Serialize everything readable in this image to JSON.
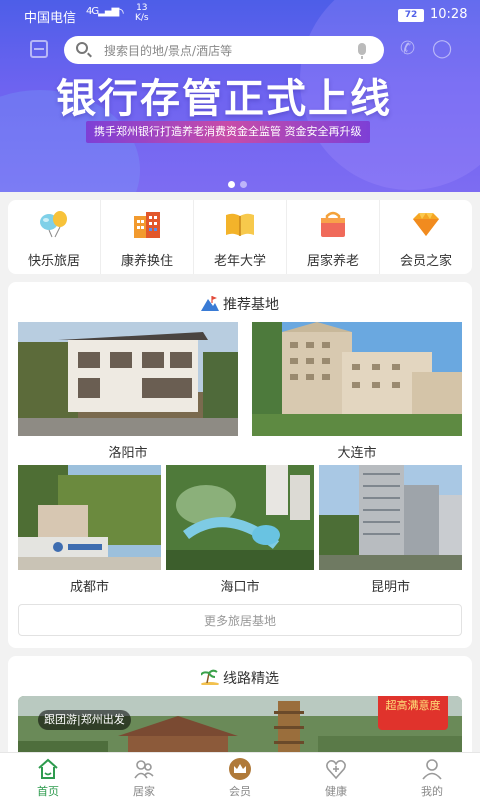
{
  "status_bar": {
    "carrier": "中国电信",
    "network": "4G",
    "speed_value": "13",
    "speed_unit": "K/s",
    "battery": "72",
    "time": "10:28"
  },
  "search": {
    "placeholder": "搜索目的地/景点/酒店等"
  },
  "banner": {
    "title": "银行存管正式上线",
    "subtitle": "携手郑州银行打造养老消费资金全监管  资金安全再升级",
    "slides": 2,
    "active_slide": 0
  },
  "categories": [
    {
      "label": "快乐旅居",
      "icon": "balloon-icon"
    },
    {
      "label": "康养换住",
      "icon": "building-icon"
    },
    {
      "label": "老年大学",
      "icon": "book-icon"
    },
    {
      "label": "居家养老",
      "icon": "shopping-bag-icon"
    },
    {
      "label": "会员之家",
      "icon": "diamond-icon"
    }
  ],
  "recommended": {
    "title": "推荐基地",
    "cities": [
      "洛阳市",
      "大连市",
      "成都市",
      "海口市",
      "昆明市"
    ],
    "more_label": "更多旅居基地"
  },
  "routes": {
    "title": "线路精选",
    "tag": "跟团游|郑州出发",
    "badge": "超高满意度"
  },
  "tabs": [
    {
      "label": "首页",
      "icon": "home-icon",
      "active": true
    },
    {
      "label": "居家",
      "icon": "family-icon",
      "active": false
    },
    {
      "label": "会员",
      "icon": "crown-icon",
      "active": false
    },
    {
      "label": "健康",
      "icon": "heart-plus-icon",
      "active": false
    },
    {
      "label": "我的",
      "icon": "user-icon",
      "active": false
    }
  ],
  "colors": {
    "banner": "#5a60ec",
    "accent": "#2e9b4e",
    "badge": "#e0332c"
  }
}
